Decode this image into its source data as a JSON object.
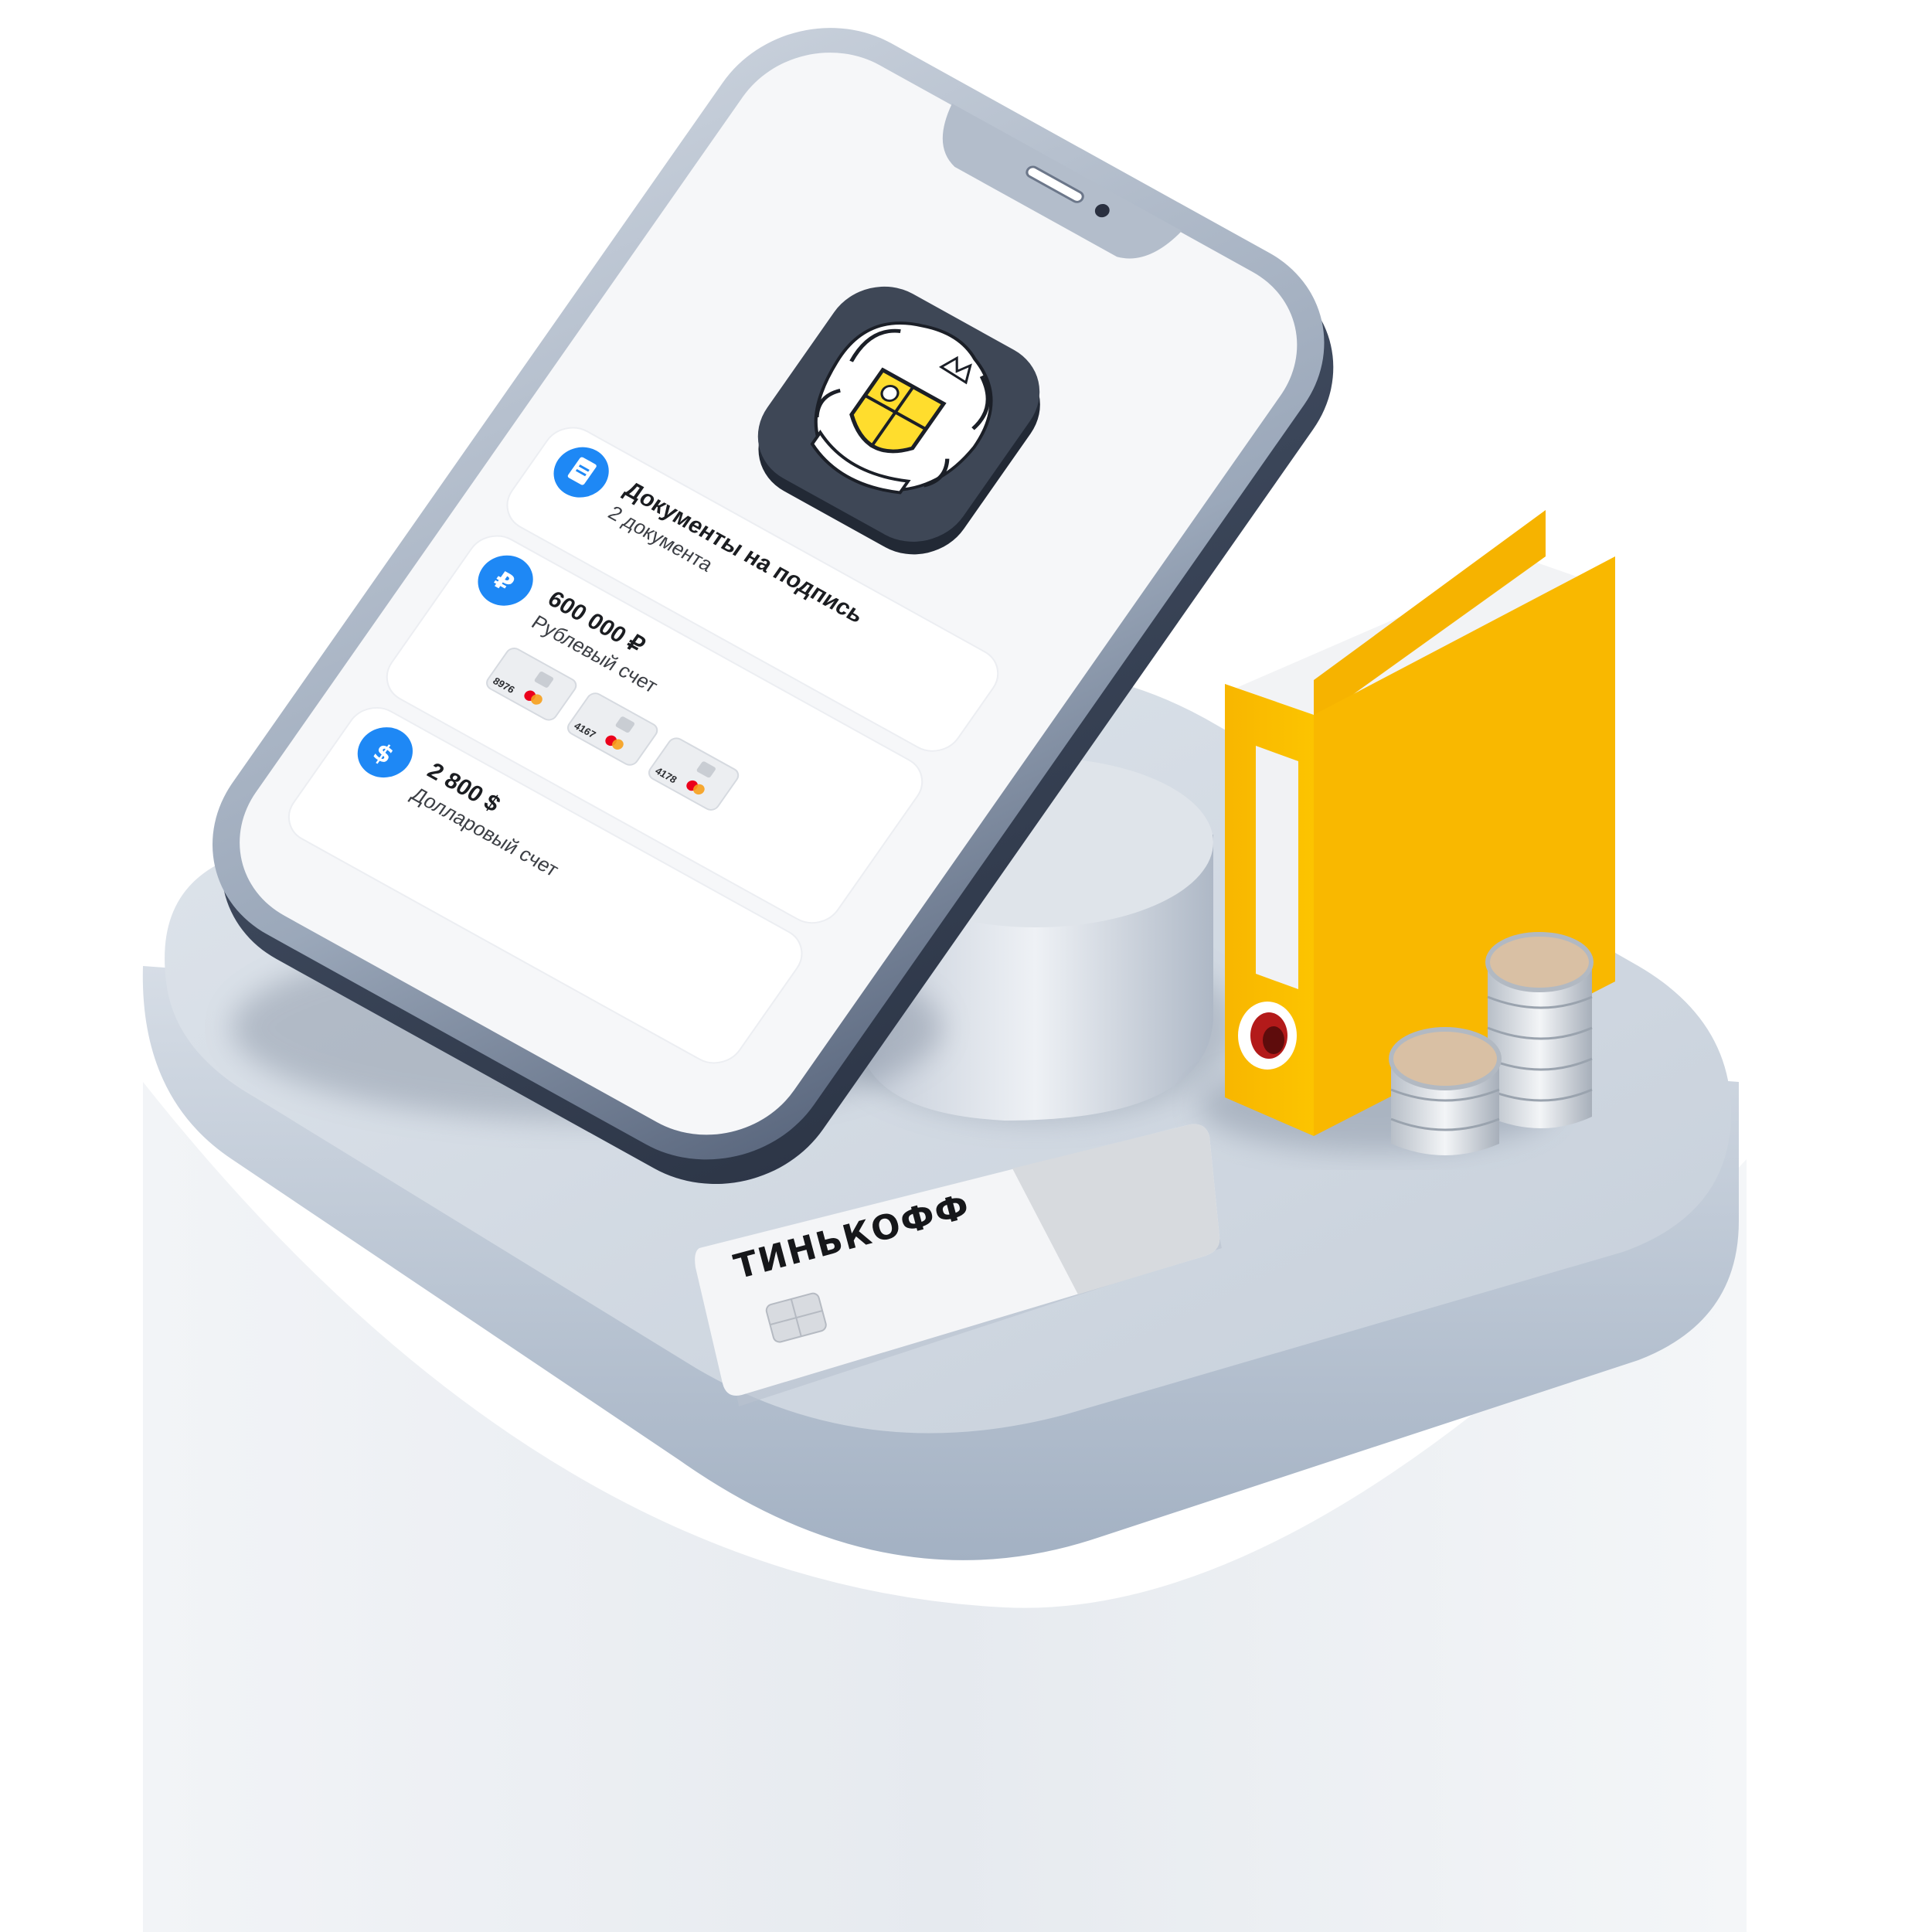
{
  "colors": {
    "accent_blue": "#1e88f5",
    "logo_tile": "#3e4756",
    "logo_yellow": "#ffdd2d",
    "binder_yellow": "#f7b500",
    "pedestal": "#c7d0dc",
    "phone_frame": "#a9b4c5"
  },
  "app": {
    "logo_icon": "tinkoff-crest-icon"
  },
  "cards": [
    {
      "icon": "document-icon",
      "title": "Документы на подпись",
      "subtitle": "2 документа"
    },
    {
      "icon": "ruble-icon",
      "title": "600 000 ₽",
      "subtitle": "Рублевый счет",
      "mini_cards": [
        "8976",
        "4167",
        "4178"
      ]
    },
    {
      "icon": "dollar-icon",
      "title": "2 800 $",
      "subtitle": "Долларовый счет"
    }
  ],
  "bank_card": {
    "brand": "ТИНЬКОФФ"
  }
}
